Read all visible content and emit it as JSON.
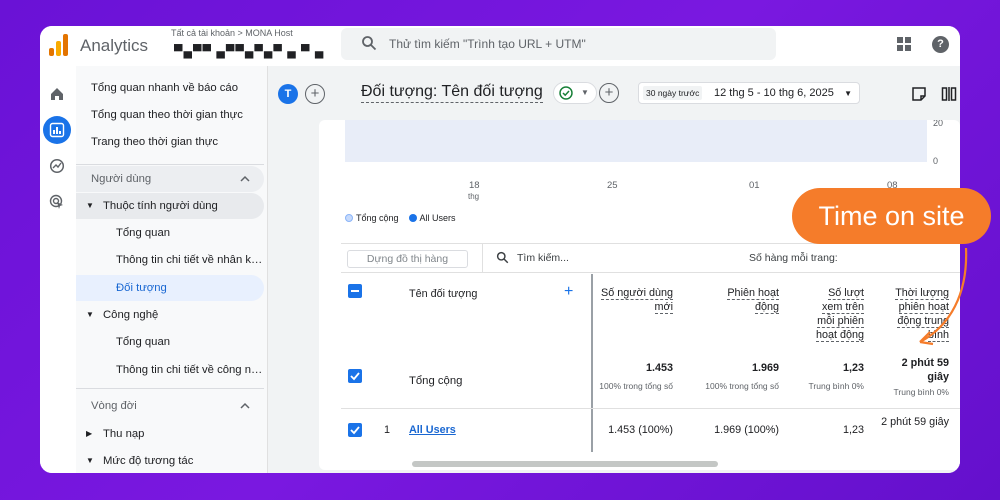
{
  "header": {
    "app_title": "Analytics",
    "account_crumb": "Tất cả tài khoản > MONA Host",
    "account_name_redacted": "▀▄▀▀ ▄▀▀▄▀▄▀ ▄ ▀ ▄",
    "search_placeholder": "Thử tìm kiếm \"Trình tạo URL + UTM\"",
    "help_label": "?"
  },
  "nav": {
    "items": [
      {
        "label": "Tổng quan nhanh về báo cáo"
      },
      {
        "label": "Tổng quan theo thời gian thực"
      },
      {
        "label": "Trang theo thời gian thực"
      }
    ],
    "section_users": "Người dùng",
    "group_user_attributes": "Thuộc tính người dùng",
    "user_attr_children": [
      "Tổng quan",
      "Thông tin chi tiết về nhân khẩu học",
      "Đối tượng"
    ],
    "group_tech": "Công nghệ",
    "tech_children": [
      "Tổng quan",
      "Thông tin chi tiết về công nghệ"
    ],
    "section_lifecycle": "Vòng đời",
    "lifecycle_groups": [
      "Thu nạp",
      "Mức độ tương tác"
    ]
  },
  "toolbar": {
    "avatar_letter": "T",
    "audience_title": "Đối tượng: Tên đối tượng",
    "date_preset": "30 ngày trước",
    "date_range": "12 thg 5 - 10 thg 6, 2025"
  },
  "chart": {
    "y_ticks": [
      "20",
      "0"
    ],
    "x_ticks": [
      "18",
      "25",
      "01",
      "08"
    ],
    "x_tick_sub": "thg",
    "legend": [
      {
        "name": "Tổng cộng",
        "color": "#c6dafc"
      },
      {
        "name": "All Users",
        "color": "#1a73e8"
      }
    ]
  },
  "table": {
    "plot_rows_label": "Dựng đồ thị hàng",
    "search_placeholder": "Tìm kiếm...",
    "rows_per_page_label": "Số hàng mỗi trang:",
    "name_header": "Tên đối tượng",
    "columns": [
      [
        "Số người dùng",
        "mới"
      ],
      [
        "Phiên hoạt",
        "động"
      ],
      [
        "Số lượt",
        "xem trên",
        "mỗi phiên",
        "hoạt động"
      ],
      [
        "Thời lượng",
        "phiên hoạt",
        "động trung",
        "bình"
      ]
    ],
    "total_label": "Tổng cộng",
    "totals": [
      "1.453",
      "1.969",
      "1,23",
      "2 phút 59 giây"
    ],
    "totals_sub": [
      "100% trong tổng số",
      "100% trong tổng số",
      "Trung bình 0%",
      "Trung bình 0%"
    ],
    "rows": [
      {
        "index": "1",
        "name": "All Users",
        "values": [
          "1.453 (100%)",
          "1.969 (100%)",
          "1,23",
          "2 phút 59 giây"
        ]
      }
    ]
  },
  "annotation": {
    "label": "Time on site",
    "color": "#f57c2a"
  }
}
